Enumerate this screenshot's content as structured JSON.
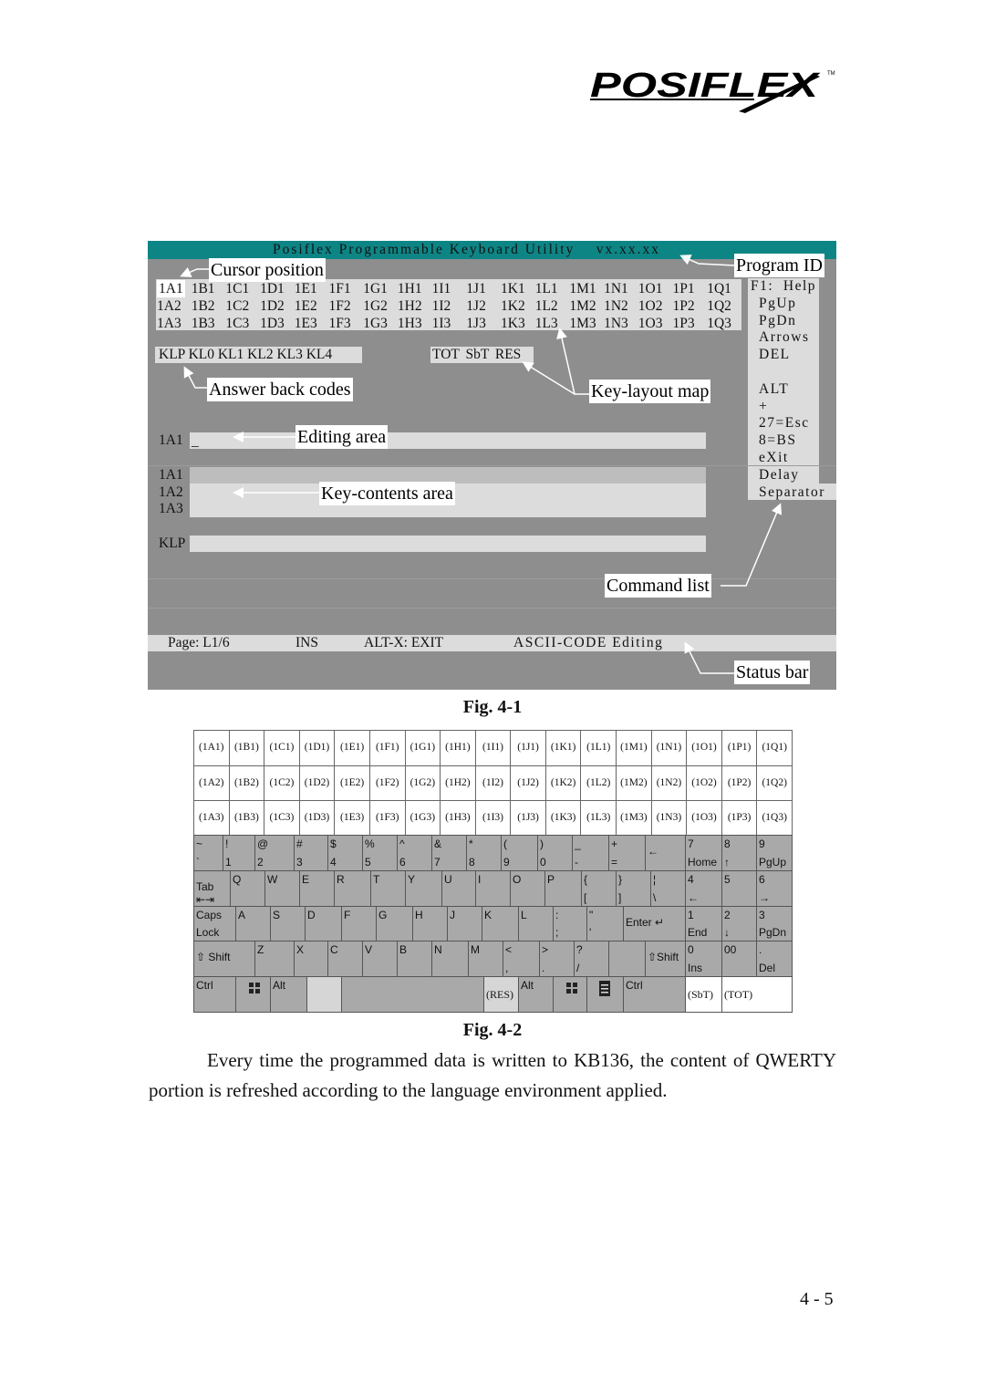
{
  "logo": {
    "text": "POSIFLEX",
    "tm": "TM"
  },
  "screen": {
    "title": "Posiflex Programmable Keyboard Utility    vx.xx.xx",
    "key_grid": [
      [
        "1A1",
        "1B1",
        "1C1",
        "1D1",
        "1E1",
        "1F1",
        "1G1",
        "1H1",
        "1I1",
        "1J1",
        "1K1",
        "1L1",
        "1M1",
        "1N1",
        "1O1",
        "1P1",
        "1Q1"
      ],
      [
        "1A2",
        "1B2",
        "1C2",
        "1D2",
        "1E2",
        "1F2",
        "1G2",
        "1H2",
        "1I2",
        "1J2",
        "1K2",
        "1L2",
        "1M2",
        "1N2",
        "1O2",
        "1P2",
        "1Q2"
      ],
      [
        "1A3",
        "1B3",
        "1C3",
        "1D3",
        "1E3",
        "1F3",
        "1G3",
        "1H3",
        "1I3",
        "1J3",
        "1K3",
        "1L3",
        "1M3",
        "1N3",
        "1O3",
        "1P3",
        "1Q3"
      ]
    ],
    "layouts": "KLP KL0 KL1 KL2 KL3 KL4",
    "answer_back": "TOT SbT RES",
    "commands": [
      "F1:  Help",
      "PgUp",
      "PgDn",
      "Arrows",
      "DEL",
      "",
      "ALT",
      "+",
      "27=Esc",
      "8=BS",
      "eXit",
      "Delay",
      "Separator"
    ],
    "editing_label": "1A1",
    "cursor": "_",
    "contents_labels": [
      "1A1",
      "1A2",
      "1A3"
    ],
    "klp_label": "KLP",
    "status": {
      "page": "Page: L1/6",
      "mode": "INS",
      "exit": "ALT-X: EXIT",
      "editing": "ASCII-CODE Editing"
    },
    "callouts": {
      "cursor_position": "Cursor position",
      "program_id": "Program ID",
      "answer_back_codes": "Answer back codes",
      "key_layout_map": "Key-layout map",
      "editing_area": "Editing area",
      "key_contents_area": "Key-contents area",
      "command_list": "Command list",
      "status_bar": "Status bar"
    },
    "colors": {
      "header": "#0e8585",
      "background": "#8e8e8e",
      "panel": "#dcdcdc"
    }
  },
  "fig1_caption": "Fig. 4-1",
  "grid": {
    "rows": [
      [
        "(1A1)",
        "(1B1)",
        "(1C1)",
        "(1D1)",
        "(1E1)",
        "(1F1)",
        "(1G1)",
        "(1H1)",
        "(1I1)",
        "(1J1)",
        "(1K1)",
        "(1L1)",
        "(1M1)",
        "(1N1)",
        "(1O1)",
        "(1P1)",
        "(1Q1)"
      ],
      [
        "(1A2)",
        "(1B2)",
        "(1C2)",
        "(1D2)",
        "(1E2)",
        "(1F2)",
        "(1G2)",
        "(1H2)",
        "(1I2)",
        "(1J2)",
        "(1K2)",
        "(1L2)",
        "(1M2)",
        "(1N2)",
        "(1O2)",
        "(1P2)",
        "(1Q2)"
      ],
      [
        "(1A3)",
        "(1B3)",
        "(1C3)",
        "(1D3)",
        "(1E3)",
        "(1F3)",
        "(1G3)",
        "(1H3)",
        "(1I3)",
        "(1J3)",
        "(1K3)",
        "(1L3)",
        "(1M3)",
        "(1N3)",
        "(1O3)",
        "(1P3)",
        "(1Q3)"
      ]
    ]
  },
  "keyboard": {
    "rows": [
      [
        {
          "t": "~",
          "b": "`"
        },
        {
          "t": "!",
          "b": "1"
        },
        {
          "t": "@",
          "b": "2"
        },
        {
          "t": "#",
          "b": "3"
        },
        {
          "t": "$",
          "b": "4"
        },
        {
          "t": "%",
          "b": "5"
        },
        {
          "t": "^",
          "b": "6"
        },
        {
          "t": "&",
          "b": "7"
        },
        {
          "t": "*",
          "b": "8"
        },
        {
          "t": "(",
          "b": "9"
        },
        {
          "t": ")",
          "b": "0"
        },
        {
          "t": "_",
          "b": "-"
        },
        {
          "t": "+",
          "b": "="
        },
        {
          "c": "←"
        },
        {
          "t": "7",
          "b": "Home"
        },
        {
          "t": "8",
          "b": "↑"
        },
        {
          "t": "9",
          "b": "PgUp"
        }
      ],
      [
        {
          "c": "Tab ⇤⇥"
        },
        {
          "t": "Q"
        },
        {
          "t": "W"
        },
        {
          "t": "E"
        },
        {
          "t": "R"
        },
        {
          "t": "T"
        },
        {
          "t": "Y"
        },
        {
          "t": "U"
        },
        {
          "t": "I"
        },
        {
          "t": "O"
        },
        {
          "t": "P"
        },
        {
          "t": "{",
          "b": "["
        },
        {
          "t": "}",
          "b": "]"
        },
        {
          "t": "¦",
          "b": "\\"
        },
        {
          "t": "4",
          "b": "←"
        },
        {
          "t": "5"
        },
        {
          "t": "6",
          "b": "→"
        }
      ],
      [
        {
          "t": "Caps",
          "b": "Lock"
        },
        {
          "t": "A"
        },
        {
          "t": "S"
        },
        {
          "t": "D"
        },
        {
          "t": "F"
        },
        {
          "t": "G"
        },
        {
          "t": "H"
        },
        {
          "t": "J"
        },
        {
          "t": "K"
        },
        {
          "t": "L"
        },
        {
          "t": ":",
          "b": ";"
        },
        {
          "t": "\"",
          "b": "'"
        },
        {
          "c": "Enter ↵"
        },
        {
          "t": "1",
          "b": "End"
        },
        {
          "t": "2",
          "b": "↓"
        },
        {
          "t": "3",
          "b": "PgDn"
        }
      ],
      [
        {
          "c": "⇧ Shift"
        },
        {
          "t": "Z"
        },
        {
          "t": "X"
        },
        {
          "t": "C"
        },
        {
          "t": "V"
        },
        {
          "t": "B"
        },
        {
          "t": "N"
        },
        {
          "t": "M"
        },
        {
          "t": "<",
          "b": ","
        },
        {
          "t": ">",
          "b": "."
        },
        {
          "t": "?",
          "b": "/"
        },
        {},
        {
          "c": "⇧Shift"
        },
        {
          "t": "0",
          "b": "Ins"
        },
        {
          "t": "00"
        },
        {
          "t": ".",
          "b": "Del"
        }
      ],
      [
        {
          "t": "Ctrl"
        },
        {
          "icon": "windows"
        },
        {
          "t": "Alt"
        },
        {
          "style": "light"
        },
        {},
        {
          "s": "(RES)",
          "style": "light"
        },
        {
          "t": "Alt"
        },
        {
          "icon": "windows"
        },
        {
          "icon": "menu"
        },
        {
          "t": "Ctrl"
        },
        {
          "s": "(SbT)",
          "style": "white"
        },
        {
          "s": "(TOT)",
          "style": "white"
        }
      ]
    ]
  },
  "fig2_caption": "Fig. 4-2",
  "paragraph": "Every time the programmed data is written to KB136, the content of QWERTY portion is refreshed according to the language environment applied.",
  "page_number": "4 - 5"
}
